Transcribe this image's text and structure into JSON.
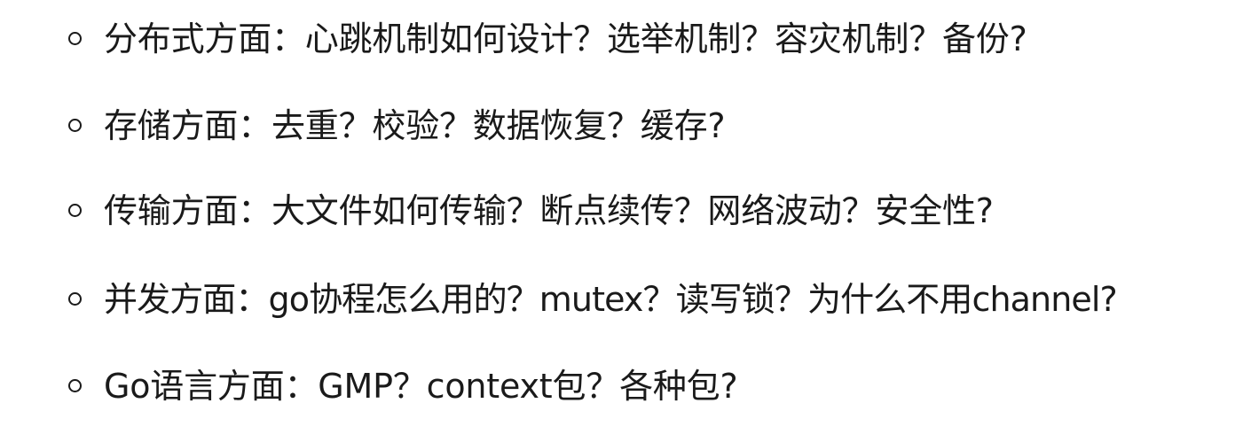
{
  "items": [
    {
      "text": "分布式方面：心跳机制如何设计？选举机制？容灾机制？备份?"
    },
    {
      "text": "存储方面：去重？校验？数据恢复？缓存?"
    },
    {
      "text": "传输方面：大文件如何传输？断点续传？网络波动？安全性?"
    },
    {
      "text": "并发方面：go协程怎么用的？mutex？读写锁？为什么不用channel?"
    },
    {
      "text": "Go语言方面：GMP？context包？各种包?"
    }
  ]
}
